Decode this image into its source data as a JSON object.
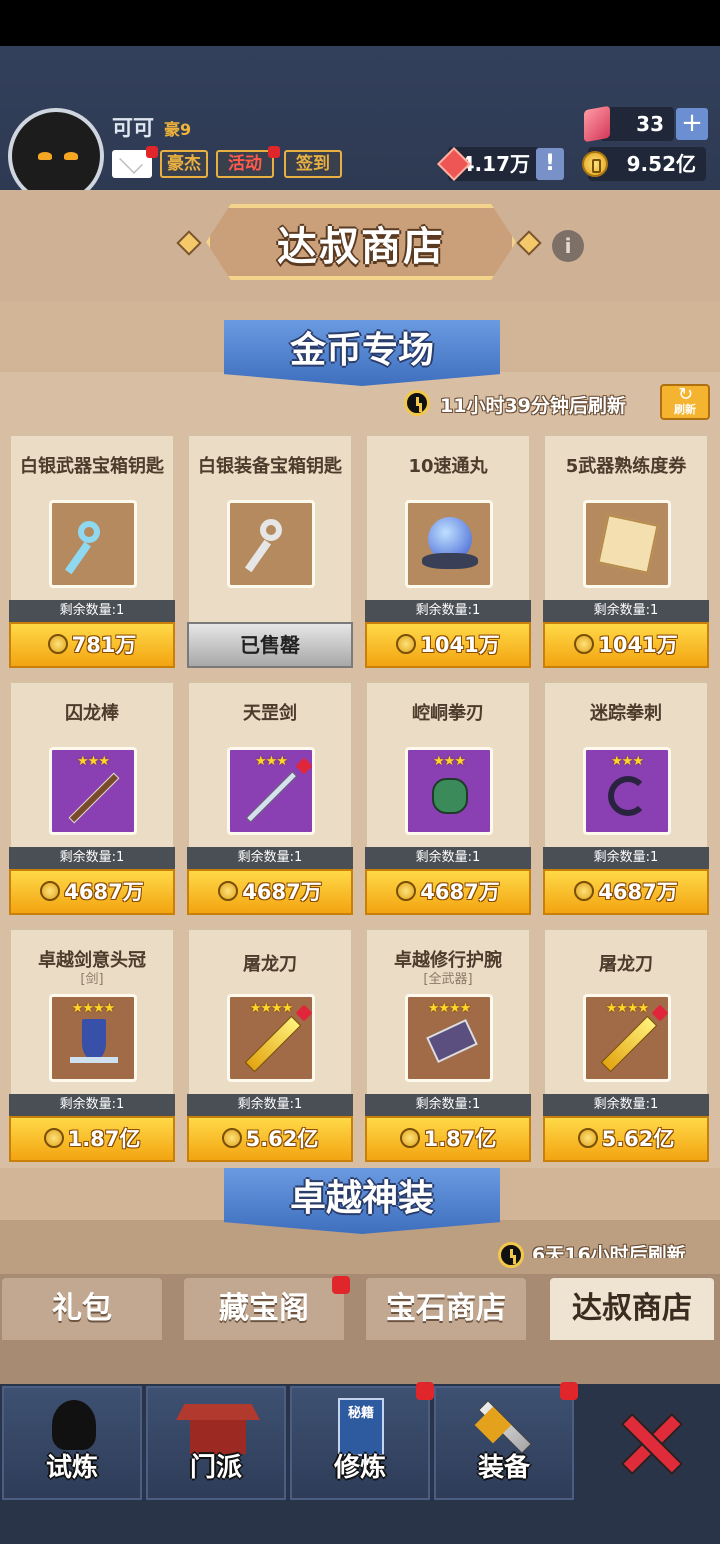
{
  "player": {
    "name": "可可",
    "vip": "豪9"
  },
  "header_buttons": {
    "hero": "豪杰",
    "event": "活动",
    "checkin": "签到"
  },
  "resources": {
    "gems": "33",
    "honor": "4.17万",
    "gold": "9.52亿"
  },
  "shop": {
    "title": "达叔商店"
  },
  "section1": {
    "title": "金币专场",
    "refresh_time": "11小时39分钟后刷新",
    "refresh_label": "刷新"
  },
  "items": [
    {
      "name": "白银武器宝箱钥匙",
      "sub": "",
      "remain": "剩余数量:1",
      "price": "781万",
      "sold": false
    },
    {
      "name": "白银装备宝箱钥匙",
      "sub": "",
      "remain": "剩余数量:1",
      "price": "已售罄",
      "sold": true
    },
    {
      "name": "10速通丸",
      "sub": "",
      "remain": "剩余数量:1",
      "price": "1041万",
      "sold": false
    },
    {
      "name": "5武器熟练度券",
      "sub": "",
      "remain": "剩余数量:1",
      "price": "1041万",
      "sold": false
    },
    {
      "name": "囚龙棒",
      "sub": "",
      "stars": "★★★",
      "remain": "剩余数量:1",
      "price": "4687万",
      "sold": false
    },
    {
      "name": "天罡剑",
      "sub": "",
      "stars": "★★★",
      "remain": "剩余数量:1",
      "price": "4687万",
      "sold": false
    },
    {
      "name": "崆峒拳刃",
      "sub": "",
      "stars": "★★★",
      "remain": "剩余数量:1",
      "price": "4687万",
      "sold": false
    },
    {
      "name": "迷踪拳刺",
      "sub": "",
      "stars": "★★★",
      "remain": "剩余数量:1",
      "price": "4687万",
      "sold": false
    },
    {
      "name": "卓越剑意头冠",
      "sub": "[剑]",
      "stars": "★★★★",
      "remain": "剩余数量:1",
      "price": "1.87亿",
      "sold": false
    },
    {
      "name": "屠龙刀",
      "sub": "",
      "stars": "★★★★",
      "remain": "剩余数量:1",
      "price": "5.62亿",
      "sold": false
    },
    {
      "name": "卓越修行护腕",
      "sub": "[全武器]",
      "stars": "★★★★",
      "remain": "剩余数量:1",
      "price": "1.87亿",
      "sold": false
    },
    {
      "name": "屠龙刀",
      "sub": "",
      "stars": "★★★★",
      "remain": "剩余数量:1",
      "price": "5.62亿",
      "sold": false
    }
  ],
  "section2": {
    "title": "卓越神装",
    "refresh_time": "6天16小时后刷新"
  },
  "tabs": [
    "礼包",
    "藏宝阁",
    "宝石商店",
    "达叔商店"
  ],
  "nav": [
    "试炼",
    "门派",
    "修炼",
    "装备"
  ],
  "nav_book_text": "秘籍",
  "colors": {
    "gold_button": "#f3a411",
    "nav_bg": "#2a3449",
    "shop_bg": "#d8bfa4"
  }
}
